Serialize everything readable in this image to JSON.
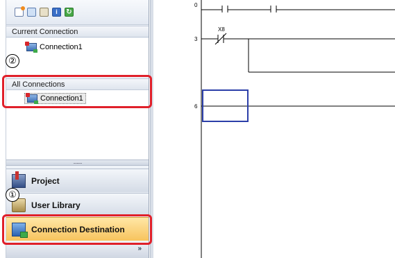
{
  "nav": {
    "toolbar_icons": [
      "new-data-icon",
      "copy-icon",
      "paste-icon",
      "info-icon",
      "refresh-icon"
    ],
    "current_connection": {
      "header": "Current Connection",
      "items": [
        "Connection1"
      ]
    },
    "all_connections": {
      "header": "All Connections",
      "items": [
        "Connection1"
      ]
    },
    "splitter_grip": "..........",
    "buttons": [
      {
        "label": "Project",
        "icon": "project-icon",
        "active": false
      },
      {
        "label": "User Library",
        "icon": "user-library-icon",
        "active": false
      },
      {
        "label": "Connection Destination",
        "icon": "connection-destination-icon",
        "active": true
      }
    ],
    "expand_glyph": "»"
  },
  "callouts": {
    "step1": "①",
    "step2": "②",
    "highlight_color": "#e0202a"
  },
  "ladder": {
    "steps": [
      "0",
      "3",
      "6"
    ],
    "devices": [
      {
        "name": "X8",
        "type": "normally-closed-contact",
        "step": "3"
      }
    ],
    "cursor_color": "#2b3ea8"
  },
  "colors": {
    "active_button": "#f7c35d",
    "panel_bg": "#eef2f8"
  }
}
